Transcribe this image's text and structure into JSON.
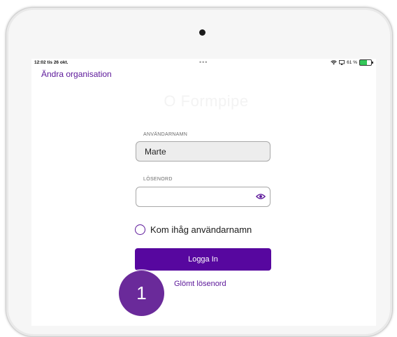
{
  "status_bar": {
    "time": "12:02  tis 26 okt.",
    "dots": "•••",
    "battery": "61 %",
    "battery_level": 0.61
  },
  "header": {
    "change_org_label": "Ändra organisation"
  },
  "logo": {
    "text": "O Formpipe"
  },
  "form": {
    "username_label": "ANVÄNDARNAMN",
    "username_value": "Marte",
    "password_label": "LÖSENORD",
    "password_value": "",
    "remember_label": "Kom ihåg användarnamn",
    "login_label": "Logga In",
    "forgot_label": "Glömt lösenord"
  },
  "annotation": {
    "step": "1"
  },
  "colors": {
    "accent": "#57079f",
    "link": "#5b1699",
    "badge": "#6a2a9a"
  },
  "icons": [
    "eye-icon",
    "radio-icon",
    "wifi-icon",
    "screen-mirror-icon",
    "battery-icon"
  ]
}
